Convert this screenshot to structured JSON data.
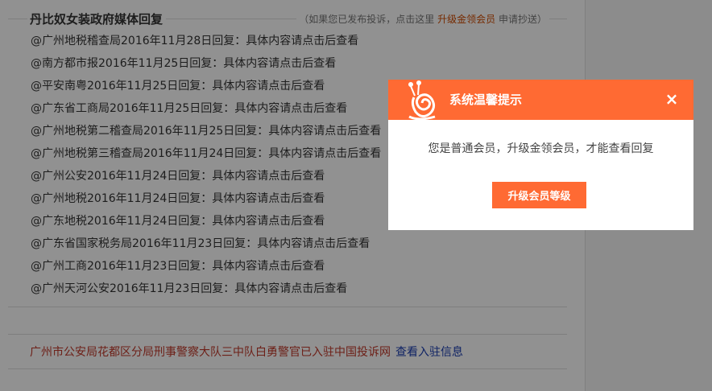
{
  "section": {
    "title": "丹比奴女装政府媒体回复",
    "note_prefix": "（如果您已发布投诉，点击这里",
    "note_link": "升级金领会员",
    "note_suffix": "申请抄送）"
  },
  "replies": [
    "@广州地税稽查局2016年11月28日回复：具体内容请点击后查看",
    "@南方都市报2016年11月25日回复：具体内容请点击后查看",
    "@平安南粤2016年11月25日回复：具体内容请点击后查看",
    "@广东省工商局2016年11月25日回复：具体内容请点击后查看",
    "@广州地税第二稽查局2016年11月25日回复：具体内容请点击后查看",
    "@广州地税第三稽查局2016年11月24日回复：具体内容请点击后查看",
    "@广州公安2016年11月24日回复：具体内容请点击后查看",
    "@广州地税2016年11月24日回复：具体内容请点击后查看",
    "@广东地税2016年11月24日回复：具体内容请点击后查看",
    "@广东省国家税务局2016年11月23日回复：具体内容请点击后查看",
    "@广州工商2016年11月23日回复：具体内容请点击后查看",
    "@广州天河公安2016年11月23日回复：具体内容请点击后查看"
  ],
  "notice": {
    "org_text": "广州市公安局花都区分局刑事警察大队三中队白勇警官已入驻中国投诉网",
    "info_link": "查看入驻信息"
  },
  "modal": {
    "title": "系统温馨提示",
    "close_icon": "×",
    "message": "您是普通会员，升级金领会员，才能查看回复",
    "button_label": "升级会员等级"
  },
  "colors": {
    "accent": "#ff6a33",
    "link_red": "#c0392b",
    "link_blue": "#1a3cb0"
  }
}
